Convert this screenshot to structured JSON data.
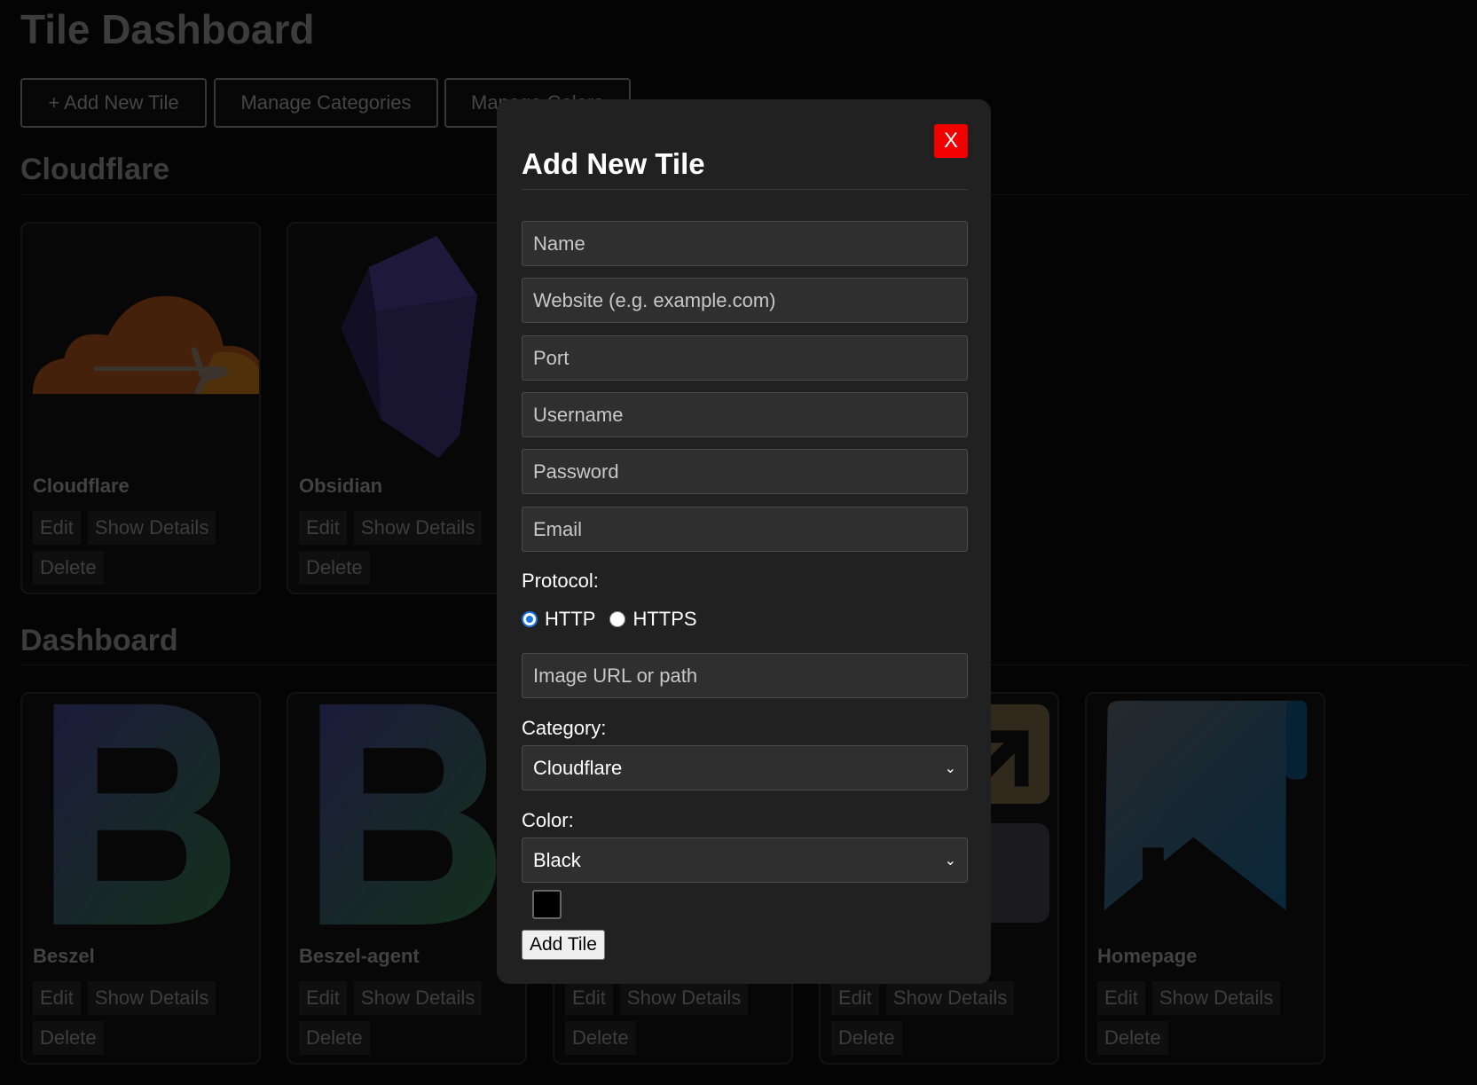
{
  "page": {
    "title": "Tile Dashboard"
  },
  "toolbar": {
    "add_tile": "+ Add New Tile",
    "manage_categories": "Manage Categories",
    "manage_colors": "Manage Colors"
  },
  "sections": [
    {
      "title": "Cloudflare",
      "tiles": [
        {
          "name": "Cloudflare"
        },
        {
          "name": "Obsidian"
        }
      ]
    },
    {
      "title": "Dashboard",
      "tiles": [
        {
          "name": "Beszel"
        },
        {
          "name": "Beszel-agent"
        },
        {
          "name": ""
        },
        {
          "name": ""
        },
        {
          "name": "Homepage"
        }
      ]
    }
  ],
  "tile_actions": {
    "edit": "Edit",
    "show_details": "Show Details",
    "delete": "Delete"
  },
  "modal": {
    "close": "X",
    "title": "Add New Tile",
    "placeholders": {
      "name": "Name",
      "website": "Website (e.g. example.com)",
      "port": "Port",
      "username": "Username",
      "password": "Password",
      "email": "Email",
      "image": "Image URL or path"
    },
    "protocol_label": "Protocol:",
    "protocol_options": [
      "HTTP",
      "HTTPS"
    ],
    "protocol_selected": "HTTP",
    "category_label": "Category:",
    "category_value": "Cloudflare",
    "color_label": "Color:",
    "color_value": "Black",
    "color_swatch": "#000000",
    "submit": "Add Tile"
  },
  "colors": {
    "close_button": "#f20000",
    "background": "#070707",
    "modal_bg": "#212121"
  }
}
